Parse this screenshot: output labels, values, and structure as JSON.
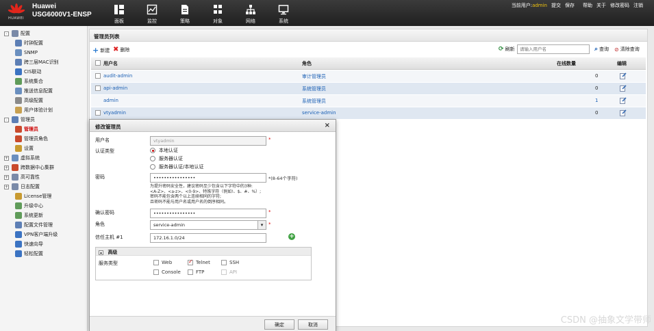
{
  "header": {
    "brand_line1": "Huawei",
    "brand_line2": "USG6000V1-ENSP",
    "logo_text": "HUAWEI",
    "nav": [
      {
        "label": "面板",
        "icon": "dashboard-icon"
      },
      {
        "label": "监控",
        "icon": "monitor-icon"
      },
      {
        "label": "策略",
        "icon": "policy-icon"
      },
      {
        "label": "对象",
        "icon": "object-icon"
      },
      {
        "label": "网络",
        "icon": "network-icon"
      },
      {
        "label": "系统",
        "icon": "system-icon"
      }
    ],
    "userbar": {
      "current_user_label": "当前用户:",
      "user": "admin",
      "commit": "提交",
      "save": "保存",
      "help": "帮助",
      "about": "关于",
      "change_password": "修改密码",
      "logout": "注销"
    }
  },
  "sidebar": {
    "items": [
      {
        "label": "配置",
        "toggle": "-",
        "icon_color": "#7a8aa8"
      },
      {
        "label": "时钟配置",
        "icon_color": "#5d7fb5"
      },
      {
        "label": "SNMP",
        "icon_color": "#6a8fbf"
      },
      {
        "label": "跨三层MAC识别",
        "icon_color": "#5d7fb5"
      },
      {
        "label": "CIS联动",
        "icon_color": "#3b73c2"
      },
      {
        "label": "系统集合",
        "icon_color": "#5f9b59"
      },
      {
        "label": "推送信息配置",
        "icon_color": "#6a8fbf"
      },
      {
        "label": "高级配置",
        "icon_color": "#8a8a8a"
      },
      {
        "label": "用户体验计划",
        "icon_color": "#c8a050"
      },
      {
        "label": "管理员",
        "toggle": "-",
        "icon_color": "#5d7fb5"
      },
      {
        "label": "管理员",
        "icon_color": "#c94a2c"
      },
      {
        "label": "管理员角色",
        "icon_color": "#c94a2c"
      },
      {
        "label": "设置",
        "icon_color": "#c89a30"
      },
      {
        "label": "虚拟系统",
        "toggle": "+",
        "icon_color": "#6a8fbf"
      },
      {
        "label": "跨数据中心集群",
        "toggle": "+",
        "icon_color": "#c94a2c"
      },
      {
        "label": "高可靠性",
        "toggle": "+",
        "icon_color": "#7a8aa8"
      },
      {
        "label": "日志配置",
        "toggle": "+",
        "icon_color": "#7a8aa8"
      },
      {
        "label": "License管理",
        "icon_color": "#c89a30"
      },
      {
        "label": "升级中心",
        "icon_color": "#5f9b59"
      },
      {
        "label": "系统更新",
        "icon_color": "#5f9b59"
      },
      {
        "label": "配置文件管理",
        "icon_color": "#5d7fb5"
      },
      {
        "label": "VPN客户端升级",
        "icon_color": "#3b73c2"
      },
      {
        "label": "快速向导",
        "icon_color": "#3b73c2"
      },
      {
        "label": "轻松配置",
        "icon_color": "#3b73c2"
      }
    ]
  },
  "main": {
    "title": "管理员列表",
    "toolbar": {
      "add": "新建",
      "delete": "删除",
      "refresh": "刷新",
      "search_placeholder": "请输入用户名",
      "query": "查询",
      "clear_query": "清除查询"
    },
    "columns": [
      "用户名",
      "角色",
      "在线数量",
      "编辑"
    ],
    "rows": [
      {
        "username": "audit-admin",
        "role": "审计管理员",
        "online": "0"
      },
      {
        "username": "api-admin",
        "role": "系统管理员",
        "online": "0"
      },
      {
        "username": "admin",
        "role": "系统管理员",
        "online": "1"
      },
      {
        "username": "vtyadmin",
        "role": "service-admin",
        "online": "0"
      }
    ]
  },
  "modal": {
    "title": "修改管理员",
    "username_label": "用户名",
    "username_value": "vtyadmin",
    "auth_type_label": "认证类型",
    "auth_options": [
      "本地认证",
      "服务器认证",
      "服务器认证/本地认证"
    ],
    "password_label": "密码",
    "password_value": "••••••••••••••••",
    "password_length_hint": "*(8-64个字符)",
    "password_rules": [
      "为提升密码安全性，建议密码至少包含以下字符中的3种:",
      "<A-Z>、<a-z>、<0-9>、特殊字符（例如!、$、#、%）;",
      "密码不能包含两个以上连续相同的字符;",
      "且密码不能与用户名或用户名的倒序相同。"
    ],
    "confirm_label": "确认密码",
    "confirm_value": "••••••••••••••••",
    "role_label": "角色",
    "role_value": "service-admin",
    "trusted_host_label": "信任主机 #1",
    "trusted_host_value": "172.16.1.0/24",
    "advanced_label": "高级",
    "service_type_label": "服务类型",
    "services": [
      {
        "label": "Web",
        "checked": false,
        "disabled": false
      },
      {
        "label": "Telnet",
        "checked": true,
        "disabled": false
      },
      {
        "label": "SSH",
        "checked": false,
        "disabled": false
      },
      {
        "label": "Console",
        "checked": false,
        "disabled": false
      },
      {
        "label": "FTP",
        "checked": false,
        "disabled": false
      },
      {
        "label": "API",
        "checked": false,
        "disabled": true
      }
    ],
    "ok": "确定",
    "cancel": "取消"
  },
  "watermark": "CSDN @抽象文学带师",
  "colors": {
    "link": "#1a5fb4",
    "accent_red": "#cc0000",
    "row_alt": "#dfe7f1"
  }
}
